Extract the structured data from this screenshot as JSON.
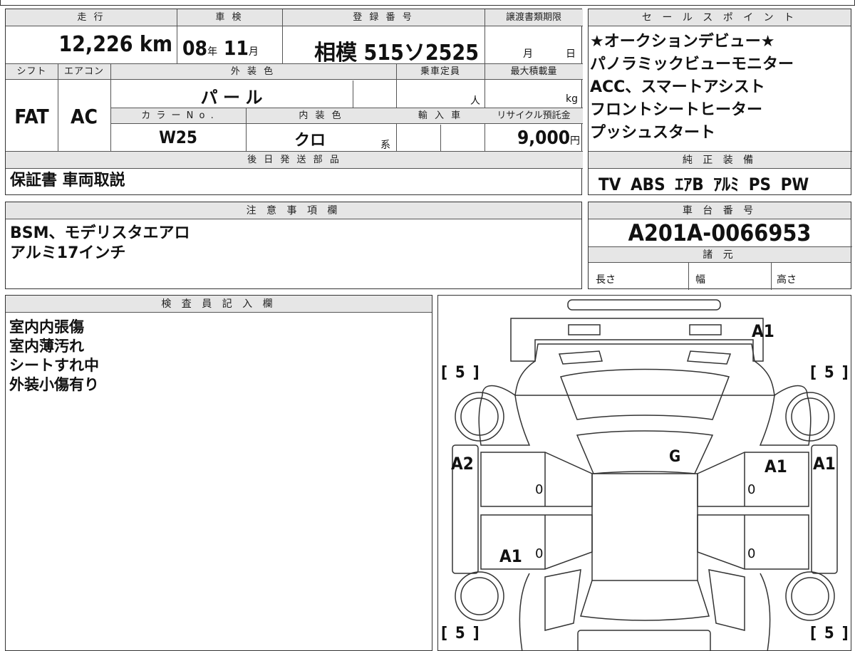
{
  "top": {
    "mileage_label": "走 行",
    "mileage_value": "12,226",
    "mileage_unit": "km",
    "inspection_label": "車 検",
    "inspection_year": "08",
    "inspection_year_unit": "年",
    "inspection_month": "11",
    "inspection_month_unit": "月",
    "registration_label": "登 録 番 号",
    "registration_value": "相模 515ソ2525",
    "transfer_label": "譲渡書類期限",
    "transfer_month_unit": "月",
    "transfer_day_unit": "日"
  },
  "row2": {
    "shift_label": "シフト",
    "shift_value": "FAT",
    "aircon_label": "エアコン",
    "aircon_value": "AC",
    "exterior_color_label": "外 装 色",
    "exterior_color_value": "パ ー ル",
    "capacity_label": "乗車定員",
    "capacity_unit": "人",
    "max_load_label": "最大積載量",
    "max_load_unit": "kg",
    "color_no_label": "カ ラ ー N o .",
    "color_no_value": "W25",
    "interior_color_label": "内 装 色",
    "interior_color_value": "クロ",
    "interior_color_unit": "系",
    "import_label": "輸 入 車",
    "recycle_label": "リサイクル預託金",
    "recycle_value": "9,000",
    "recycle_unit": "円"
  },
  "later_parts": {
    "label": "後 日 発 送 部 品",
    "value": "保証書 車両取説"
  },
  "sales_points": {
    "label": "セ ー ル ス ポ イ ン ト",
    "items": [
      "★オークションデビュー★",
      "パノラミックビューモニター",
      "ACC、スマートアシスト",
      "フロントシートヒーター",
      "プッシュスタート"
    ]
  },
  "equipment": {
    "label": "純 正 装 備",
    "items": [
      "TV",
      "ABS",
      "ｴｱB",
      "ｱﾙﾐ",
      "PS",
      "PW"
    ]
  },
  "notes": {
    "label": "注 意 事 項 欄",
    "lines": [
      "BSM、モデリスタエアロ",
      "アルミ17インチ"
    ]
  },
  "chassis": {
    "label": "車 台 番 号",
    "value": "A201A-0066953",
    "specs_label": "諸 元",
    "length_label": "長さ",
    "width_label": "幅",
    "height_label": "高さ"
  },
  "inspector": {
    "label": "検 査 員 記 入 欄",
    "lines": [
      "室内内張傷",
      "室内薄汚れ",
      "シートすれ中",
      "外装小傷有り"
    ]
  },
  "diagram": {
    "tire_fl": "[ 5 ]",
    "tire_fr": "[ 5 ]",
    "tire_rl": "[ 5 ]",
    "tire_rr": "[ 5 ]",
    "front_bumper": "A1",
    "windshield": "G",
    "left_front_door": "A2",
    "right_front_door": "A1",
    "right_fender": "A1",
    "left_rear_door": "A1",
    "zero_1": "0",
    "zero_2": "0",
    "zero_3": "0",
    "zero_4": "0"
  }
}
